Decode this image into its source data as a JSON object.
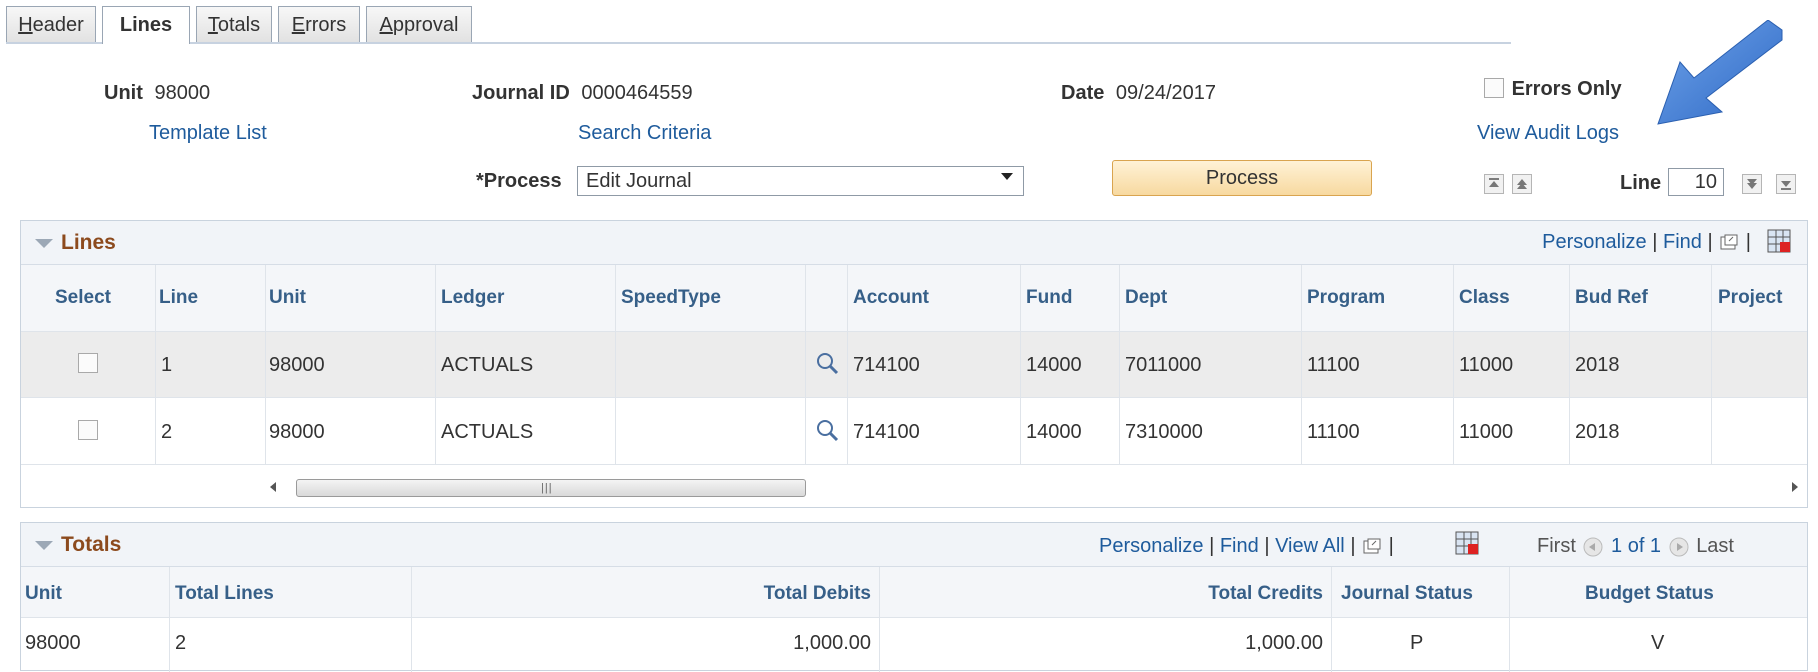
{
  "tabs": [
    {
      "label": "Header",
      "underline": "H",
      "rest": "eader",
      "active": false
    },
    {
      "label": "Lines",
      "active": true
    },
    {
      "label": "Totals",
      "underline": "T",
      "rest": "otals",
      "active": false
    },
    {
      "label": "Errors",
      "underline": "E",
      "rest": "rrors",
      "active": false
    },
    {
      "label": "Approval",
      "underline": "A",
      "rest": "pproval",
      "active": false
    }
  ],
  "header": {
    "unit_label": "Unit",
    "unit_value": "98000",
    "journal_label": "Journal ID",
    "journal_value": "0000464559",
    "date_label": "Date",
    "date_value": "09/24/2017",
    "errors_only_label": "Errors Only",
    "template_list": "Template List",
    "search_criteria": "Search Criteria",
    "view_audit_logs": "View Audit Logs",
    "process_label": "*Process",
    "process_value": "Edit Journal",
    "process_button": "Process",
    "line_label": "Line",
    "line_value": "10"
  },
  "lines_grid": {
    "title": "Lines",
    "personalize": "Personalize",
    "find": "Find",
    "separator": "|",
    "columns": [
      "Select",
      "Line",
      "Unit",
      "Ledger",
      "SpeedType",
      "Account",
      "Fund",
      "Dept",
      "Program",
      "Class",
      "Bud Ref",
      "Project"
    ],
    "rows": [
      {
        "line": "1",
        "unit": "98000",
        "ledger": "ACTUALS",
        "speedtype": "",
        "account": "714100",
        "fund": "14000",
        "dept": "7011000",
        "program": "11100",
        "class": "11000",
        "budref": "2018",
        "project": ""
      },
      {
        "line": "2",
        "unit": "98000",
        "ledger": "ACTUALS",
        "speedtype": "",
        "account": "714100",
        "fund": "14000",
        "dept": "7310000",
        "program": "11100",
        "class": "11000",
        "budref": "2018",
        "project": ""
      }
    ]
  },
  "totals_grid": {
    "title": "Totals",
    "personalize": "Personalize",
    "find": "Find",
    "view_all": "View All",
    "separator": "|",
    "first": "First",
    "pager": "1 of 1",
    "last": "Last",
    "columns": [
      "Unit",
      "Total Lines",
      "Total Debits",
      "Total Credits",
      "Journal Status",
      "Budget Status"
    ],
    "row": {
      "unit": "98000",
      "total_lines": "2",
      "total_debits": "1,000.00",
      "total_credits": "1,000.00",
      "journal_status": "P",
      "budget_status": "V"
    }
  },
  "colors": {
    "link": "#1e5b9c",
    "grid_title": "#8c4a1d",
    "column_header": "#365f88",
    "annotation_arrow": "#3b78d4"
  }
}
